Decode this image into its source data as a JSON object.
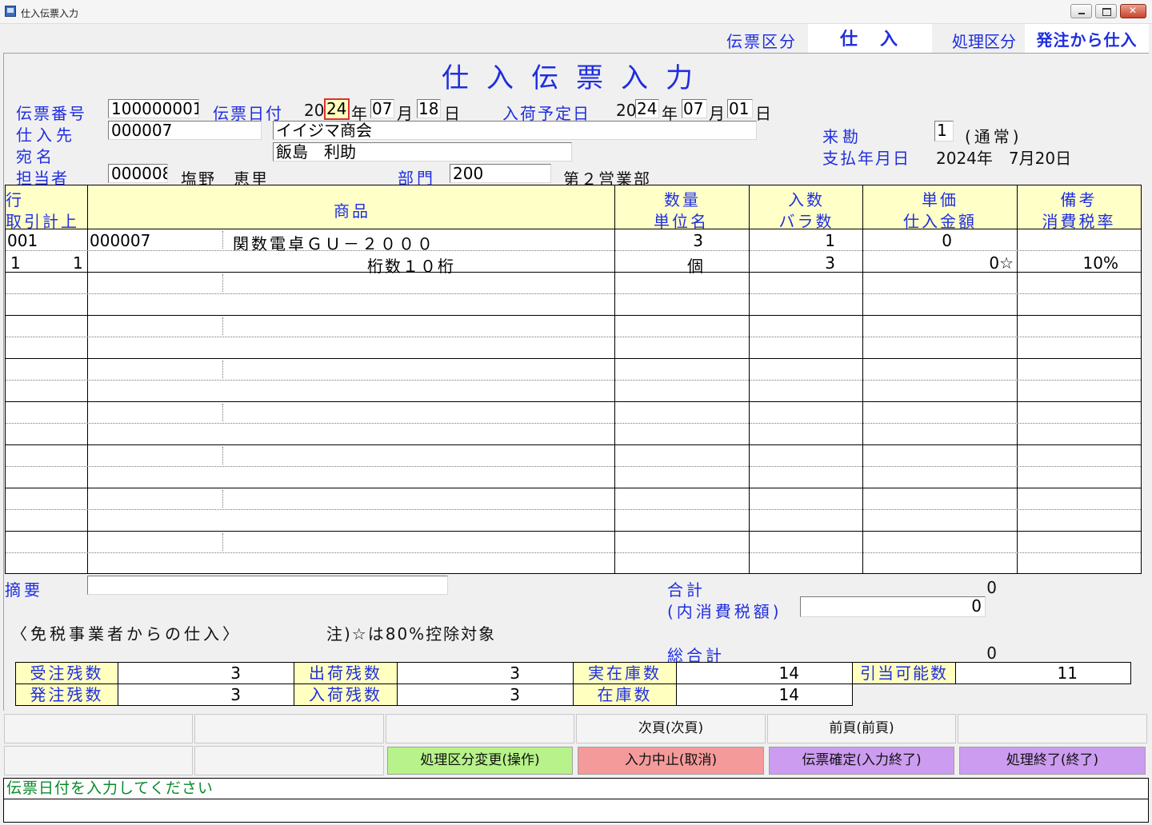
{
  "window": {
    "title": "仕入伝票入力"
  },
  "header": {
    "slip_type_label": "伝票区分",
    "slip_type_value": "仕　入",
    "process_type_label": "処理区分",
    "process_type_value": "発注から仕入"
  },
  "form_title": "仕入伝票入力",
  "form": {
    "slip_no_label": "伝票番号",
    "slip_no": "100000001",
    "slip_date_label": "伝票日付",
    "slip_date_prefix": "20",
    "slip_date_year": "24",
    "year_char": "年",
    "slip_date_month": "07",
    "month_char": "月",
    "slip_date_day": "18",
    "day_char": "日",
    "arrival_label": "入荷予定日",
    "arrival_prefix": "20",
    "arrival_year": "24",
    "arrival_month": "07",
    "arrival_day": "01",
    "supplier_label": "仕入先",
    "supplier_code": "000007",
    "supplier_name": "イイジマ商会",
    "addressee_label": "宛名",
    "addressee": "飯島　利助",
    "visit_label": "来勘",
    "visit_code": "1",
    "visit_desc": "(通常)",
    "pay_date_label": "支払年月日",
    "pay_date": "2024年　7月20日",
    "staff_label": "担当者",
    "staff_code": "000008",
    "staff_name": "塩野　恵里",
    "dept_label": "部門",
    "dept_code": "200",
    "dept_name": "第２営業部"
  },
  "grid": {
    "headers": {
      "row": "行",
      "tx": "取引計上",
      "product": "商品",
      "qty": "数量",
      "unit": "単位名",
      "per_case": "入数",
      "loose": "バラ数",
      "unit_price": "単価",
      "amount": "仕入金額",
      "note": "備考",
      "tax_rate": "消費税率"
    },
    "rows": [
      {
        "row_no": "001",
        "tx_a": "1",
        "tx_b": "1",
        "code": "000007",
        "name": "関数電卓ＧＵ－２０００",
        "spec": "桁数１０桁",
        "qty": "3",
        "unit": "個",
        "per_case": "1",
        "loose": "3",
        "unit_price": "0",
        "amount": "0☆",
        "note": "",
        "tax_rate": "10%"
      }
    ]
  },
  "summary": {
    "memo_label": "摘要",
    "memo": "",
    "total_label": "合計",
    "total": "0",
    "tax_label": "(内消費税額)",
    "tax": "0",
    "exempt_note": "〈免税事業者からの仕入〉",
    "deduct_note": "注)☆は80%控除対象",
    "grand_total_label": "総合計",
    "grand_total": "0"
  },
  "stock": {
    "order_remain_label": "受注残数",
    "order_remain": "3",
    "ship_remain_label": "出荷残数",
    "ship_remain": "3",
    "actual_stock_label": "実在庫数",
    "actual_stock": "14",
    "allocatable_label": "引当可能数",
    "allocatable": "11",
    "po_remain_label": "発注残数",
    "po_remain": "3",
    "arrival_remain_label": "入荷残数",
    "arrival_remain": "3",
    "stock_label": "在庫数",
    "stock": "14"
  },
  "buttons": {
    "next_page": "次頁(次頁)",
    "prev_page": "前頁(前頁)",
    "change_mode": "処理区分変更(操作)",
    "cancel_input": "入力中止(取消)",
    "confirm_slip": "伝票確定(入力終了)",
    "end_process": "処理終了(終了)"
  },
  "colors": {
    "label_blue": "#1f2ee0",
    "header_yellow": "#ffffc8",
    "btn_green": "#b7f28a",
    "btn_red": "#f49a9a",
    "btn_purple": "#cc9cf0",
    "status_green": "#0a8a2a"
  },
  "status_message": "伝票日付を入力してください"
}
